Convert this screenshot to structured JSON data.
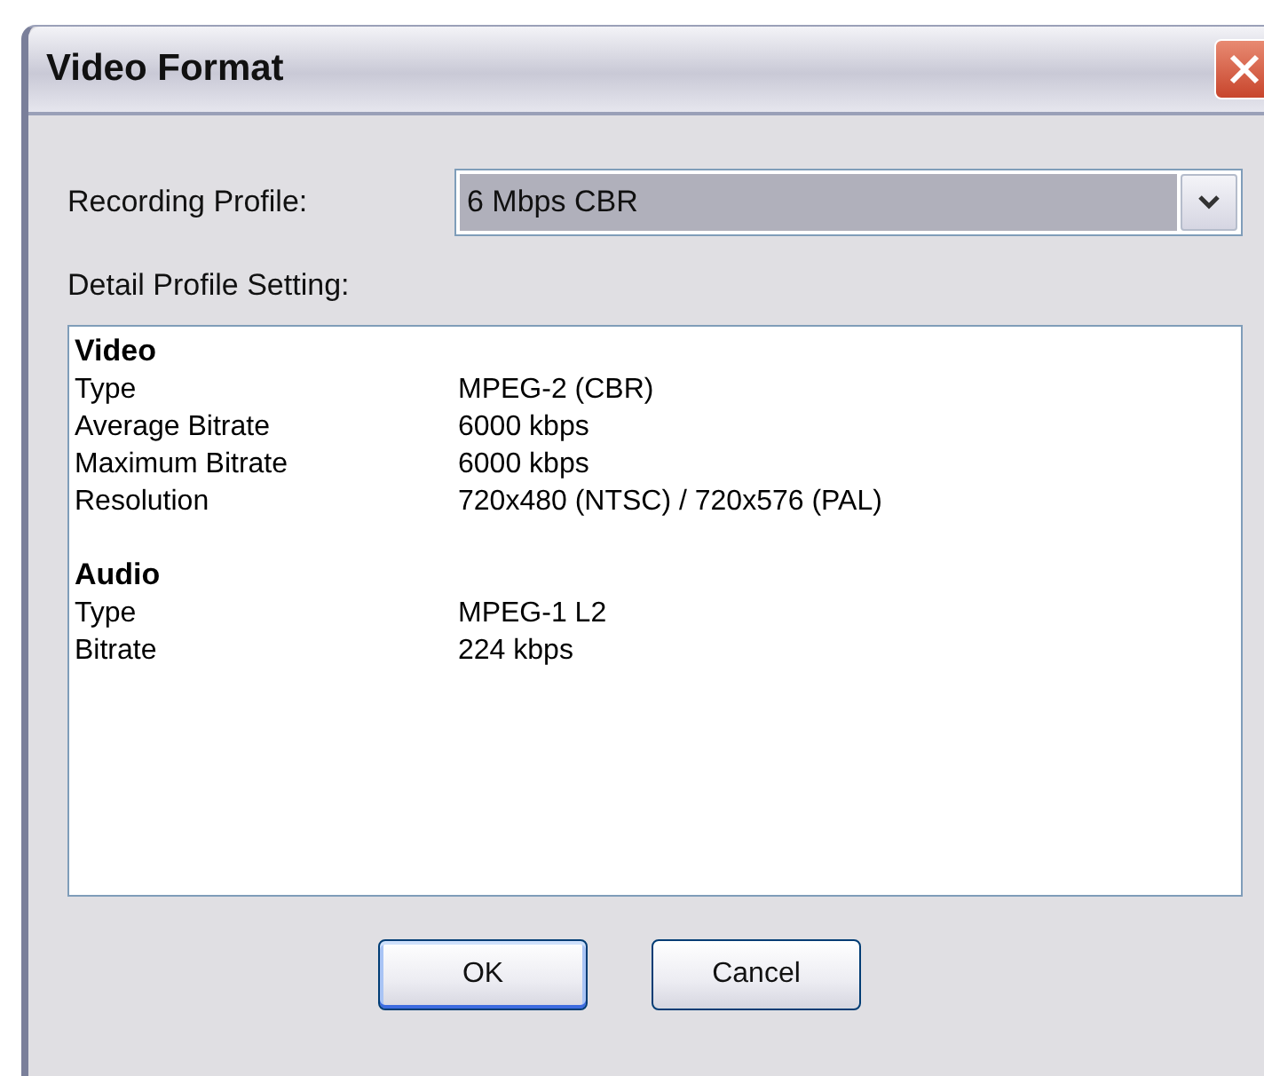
{
  "window": {
    "title": "Video Format"
  },
  "recording_profile": {
    "label": "Recording Profile:",
    "value": "6 Mbps CBR"
  },
  "detail": {
    "label": "Detail Profile Setting:",
    "sections": [
      {
        "heading": "Video",
        "rows": [
          {
            "name": "Type",
            "value": "MPEG-2 (CBR)"
          },
          {
            "name": "Average Bitrate",
            "value": "6000 kbps"
          },
          {
            "name": "Maximum Bitrate",
            "value": "6000 kbps"
          },
          {
            "name": "Resolution",
            "value": "720x480 (NTSC) / 720x576 (PAL)"
          }
        ]
      },
      {
        "heading": "Audio",
        "rows": [
          {
            "name": "Type",
            "value": "MPEG-1 L2"
          },
          {
            "name": "Bitrate",
            "value": "224 kbps"
          }
        ]
      }
    ]
  },
  "buttons": [
    {
      "label": "OK",
      "default": true
    },
    {
      "label": "Cancel",
      "default": false
    }
  ]
}
